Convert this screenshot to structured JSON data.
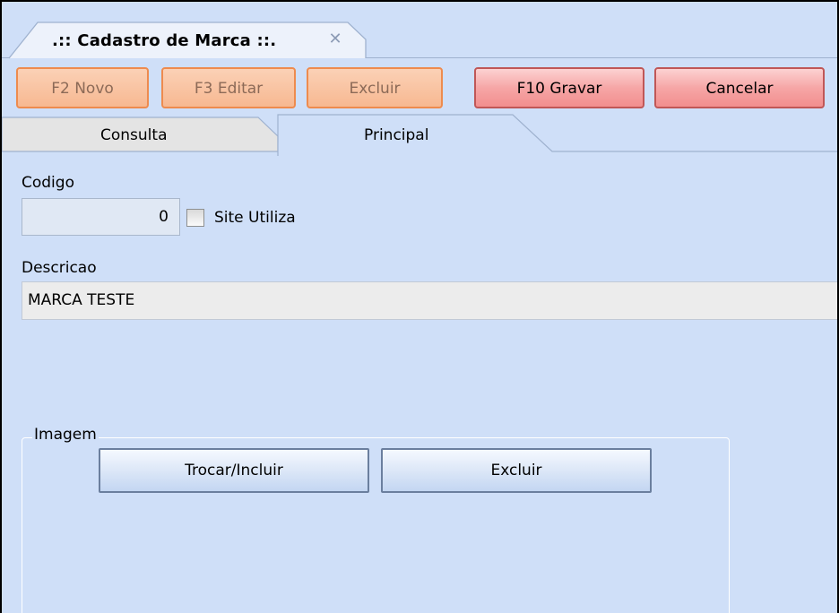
{
  "window": {
    "doc_tab_title": ".:: Cadastro de Marca ::.",
    "doc_tab_close": "✕"
  },
  "toolbar": {
    "novo_label": "F2 Novo",
    "editar_label": "F3 Editar",
    "excluir_label": "Excluir",
    "gravar_label": "F10 Gravar",
    "cancelar_label": "Cancelar"
  },
  "tabs": [
    {
      "label": "Consulta",
      "active": false
    },
    {
      "label": "Principal",
      "active": true
    }
  ],
  "form": {
    "codigo_label": "Codigo",
    "codigo_value": "0",
    "site_utiliza_label": "Site Utiliza",
    "site_utiliza_checked": false,
    "descricao_label": "Descricao",
    "descricao_value": "MARCA TESTE"
  },
  "imagem": {
    "legend": "Imagem",
    "trocar_label": "Trocar/Incluir",
    "excluir_label": "Excluir"
  },
  "colors": {
    "background": "#cfdff8",
    "disabled_button_border": "#ee8b4e",
    "active_button_fill": "#f6a6a6"
  }
}
